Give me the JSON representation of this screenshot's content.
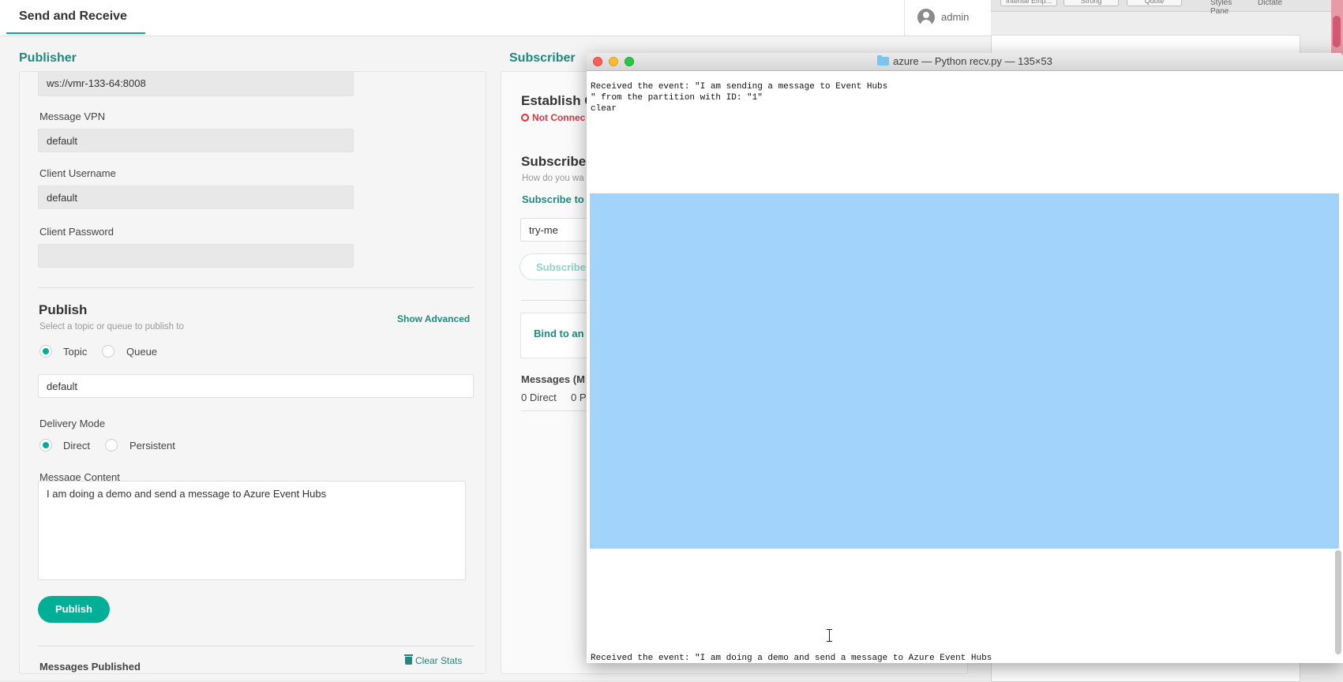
{
  "background_app": {
    "styles": [
      "Intense Emp...",
      "Strong",
      "Quote"
    ],
    "pane_label": "Styles\nPane",
    "dictate": "Dictate"
  },
  "app": {
    "title": "Send and Receive",
    "user": "admin",
    "accent_color": "#00af96"
  },
  "publisher": {
    "heading": "Publisher",
    "url_value": "ws://vmr-133-64:8008",
    "vpn_label": "Message VPN",
    "vpn_value": "default",
    "username_label": "Client Username",
    "username_value": "default",
    "password_label": "Client Password",
    "password_value": "",
    "publish_heading": "Publish",
    "publish_hint": "Select a topic or queue to publish to",
    "show_advanced": "Show Advanced",
    "dest_options": [
      "Topic",
      "Queue"
    ],
    "dest_selected": "Topic",
    "topic_value": "default",
    "delivery_label": "Delivery Mode",
    "delivery_options": [
      "Direct",
      "Persistent"
    ],
    "delivery_selected": "Direct",
    "content_label": "Message Content",
    "content_value": "I am doing a demo and send a message to Azure Event Hubs",
    "publish_button": "Publish",
    "messages_published": "Messages Published",
    "clear_stats": "Clear Stats"
  },
  "subscriber": {
    "heading": "Subscriber",
    "establish_heading": "Establish C",
    "status": "Not Connec",
    "subscribe_heading": "Subscribe",
    "subscribe_hint": "How do you wa",
    "subscribe_to": "Subscribe to",
    "topic_value": "try-me",
    "subscribe_button": "Subscribe",
    "bind_label": "Bind to an",
    "messages_label": "Messages  (M",
    "direct_count": "0 Direct",
    "persistent_count": "0 P",
    "status_color": "#e0323f"
  },
  "terminal": {
    "title": "azure — Python recv.py — 135×53",
    "lines": [
      "Received the event: \"I am sending a message to Event Hubs",
      "\" from the partition with ID: \"1\"",
      "clear"
    ],
    "bottom_line": "Received the event: \"I am doing a demo and send a message to Azure Event Hubs",
    "selection_color": "#a2d3fa"
  }
}
